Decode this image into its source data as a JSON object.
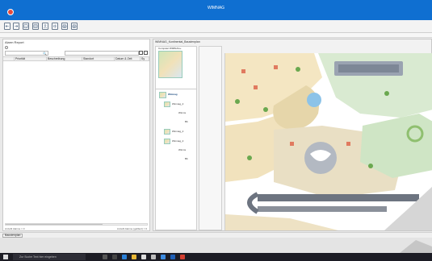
{
  "window": {
    "title": "WIMNAG"
  },
  "left_panel": {
    "title": "Alarm Report",
    "columns": [
      "",
      "Priorität",
      "Beschreibung",
      "Standort",
      "Datum & Zeit",
      "Sy"
    ],
    "footer_left": "Anzahl Alarme = 0",
    "footer_right": "Anzahl Alarme (gefiltert) = 0"
  },
  "right_panel": {
    "title": "WIMNAG_Kontinental_Baustenplan",
    "tab": "Computer:WIMNAG+.",
    "tree": {
      "root": "Wimnag",
      "nodes": [
        "Wimnag_2",
        "Wimnag_2",
        "Wimnag_2"
      ],
      "sub1": "Wimns",
      "sub2": "Wimns",
      "small": "Bb"
    }
  },
  "statusbar": {
    "button": "Baustenplan"
  },
  "taskbar": {
    "search_placeholder": "Zur Suche Text hier eingeben"
  },
  "colors": {
    "titlebar": "#0f6fd1",
    "taskbar": "#1c1c24",
    "accent_red": "#e64a3c"
  }
}
